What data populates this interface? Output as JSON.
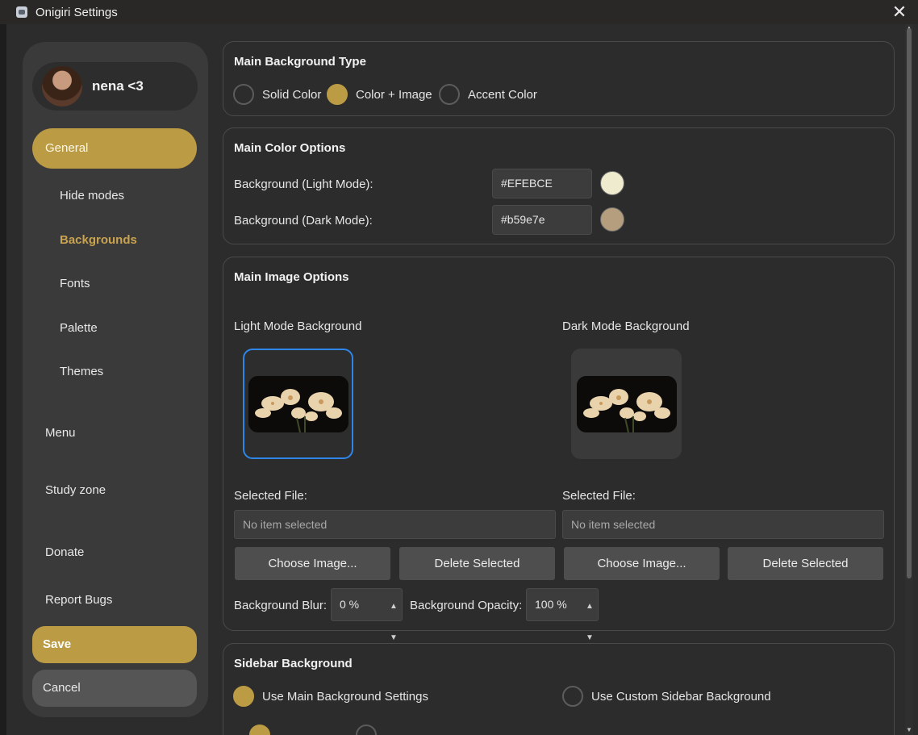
{
  "window": {
    "title": "Onigiri Settings",
    "close_glyph": "✕"
  },
  "profile": {
    "name": "nena <3"
  },
  "sidebar": {
    "general": "General",
    "sub_items": [
      {
        "label": "Hide modes"
      },
      {
        "label": "Backgrounds"
      },
      {
        "label": "Fonts"
      },
      {
        "label": "Palette"
      },
      {
        "label": "Themes"
      }
    ],
    "menu": "Menu",
    "study_zone": "Study zone",
    "donate": "Donate",
    "report_bugs": "Report Bugs",
    "save": "Save",
    "cancel": "Cancel"
  },
  "main_bg_type": {
    "title": "Main Background Type",
    "options": [
      "Solid Color",
      "Color + Image",
      "Accent Color"
    ],
    "selected": "Color + Image"
  },
  "main_color": {
    "title": "Main Color Options",
    "light_label": "Background (Light Mode):",
    "light_value": "#EFEBCE",
    "dark_label": "Background (Dark Mode):",
    "dark_value": "#b59e7e"
  },
  "main_image": {
    "title": "Main Image Options",
    "light_label": "Light Mode Background",
    "dark_label": "Dark Mode Background",
    "selected_file_label": "Selected File:",
    "file_placeholder": "No item selected",
    "choose_label": "Choose Image...",
    "delete_label": "Delete Selected",
    "blur_label": "Background Blur:",
    "blur_value": "0 %",
    "opacity_label": "Background Opacity:",
    "opacity_value": "100 %"
  },
  "sidebar_bg": {
    "title": "Sidebar Background",
    "use_main": "Use Main Background Settings",
    "use_custom": "Use Custom Sidebar Background",
    "selected": "Use Main Background Settings"
  },
  "colors": {
    "accent": "#bc9b45",
    "light_swatch": "#EFEBCE",
    "dark_swatch": "#b59e7e",
    "selection": "#2f86e8"
  }
}
